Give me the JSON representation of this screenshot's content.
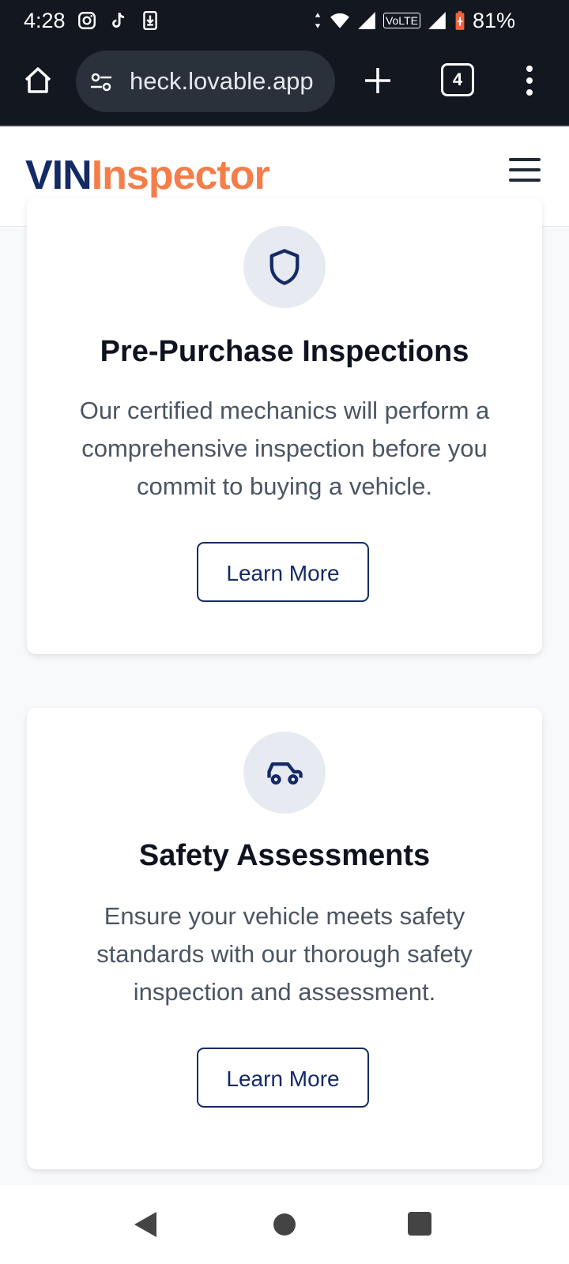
{
  "status_bar": {
    "time": "4:28",
    "battery": "81%",
    "network": "VoLTE",
    "icons_left": [
      "instagram-icon",
      "tiktok-icon",
      "download-icon"
    ],
    "icons_right": [
      "data-arrows-icon",
      "wifi-icon",
      "signal-icon",
      "volte-icon",
      "signal-icon",
      "battery-icon"
    ]
  },
  "browser": {
    "url": "heck.lovable.app",
    "tab_count": "4",
    "icons": [
      "home-icon",
      "site-settings-icon",
      "new-tab-icon",
      "tabs-icon",
      "more-menu-icon"
    ]
  },
  "header": {
    "logo_part1": "VIN",
    "logo_part2": "Inspector",
    "logo_colors": {
      "vin": "#142a66",
      "inspector": "#f57d4a"
    },
    "menu_icon": "hamburger-icon"
  },
  "cards": [
    {
      "icon": "shield-icon",
      "title": "Pre-Purchase Inspections",
      "description": "Our certified mechanics will perform a comprehensive inspection before you commit to buying a vehicle.",
      "button_label": "Learn More"
    },
    {
      "icon": "car-icon",
      "title": "Safety Assessments",
      "description": "Ensure your vehicle meets safety standards with our thorough safety inspection and assessment.",
      "button_label": "Learn More"
    }
  ],
  "nav_bar": {
    "buttons": [
      "back-icon",
      "home-icon",
      "recents-icon"
    ]
  }
}
